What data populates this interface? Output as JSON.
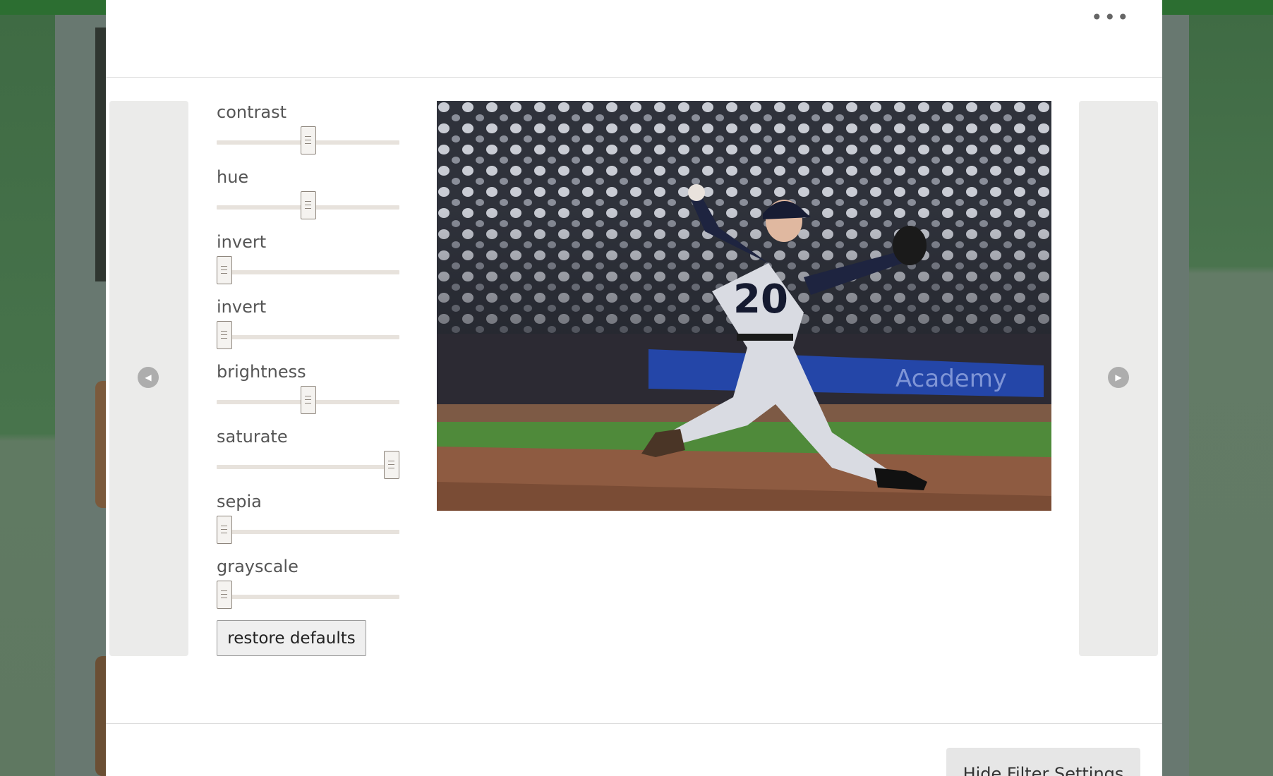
{
  "header": {
    "more_label": "•••"
  },
  "navigation": {
    "prev_glyph": "◀",
    "next_glyph": "▶"
  },
  "filters": [
    {
      "label": "contrast",
      "level": 0.5
    },
    {
      "label": "hue",
      "level": 0.5
    },
    {
      "label": "invert",
      "level": 0.0
    },
    {
      "label": "invert",
      "level": 0.0
    },
    {
      "label": "brightness",
      "level": 0.5
    },
    {
      "label": "saturate",
      "level": 1.0
    },
    {
      "label": "sepia",
      "level": 0.0
    },
    {
      "label": "grayscale",
      "level": 0.0
    }
  ],
  "restore_label": "restore defaults",
  "photo": {
    "jersey_number": "20",
    "banner_text": "Academy"
  },
  "footer": {
    "hide_label": "Hide Filter Settings"
  },
  "colors": {
    "top_bar": "#2c6e31",
    "slider_track": "#e7e2dc",
    "nav_panel": "#ebebea"
  }
}
